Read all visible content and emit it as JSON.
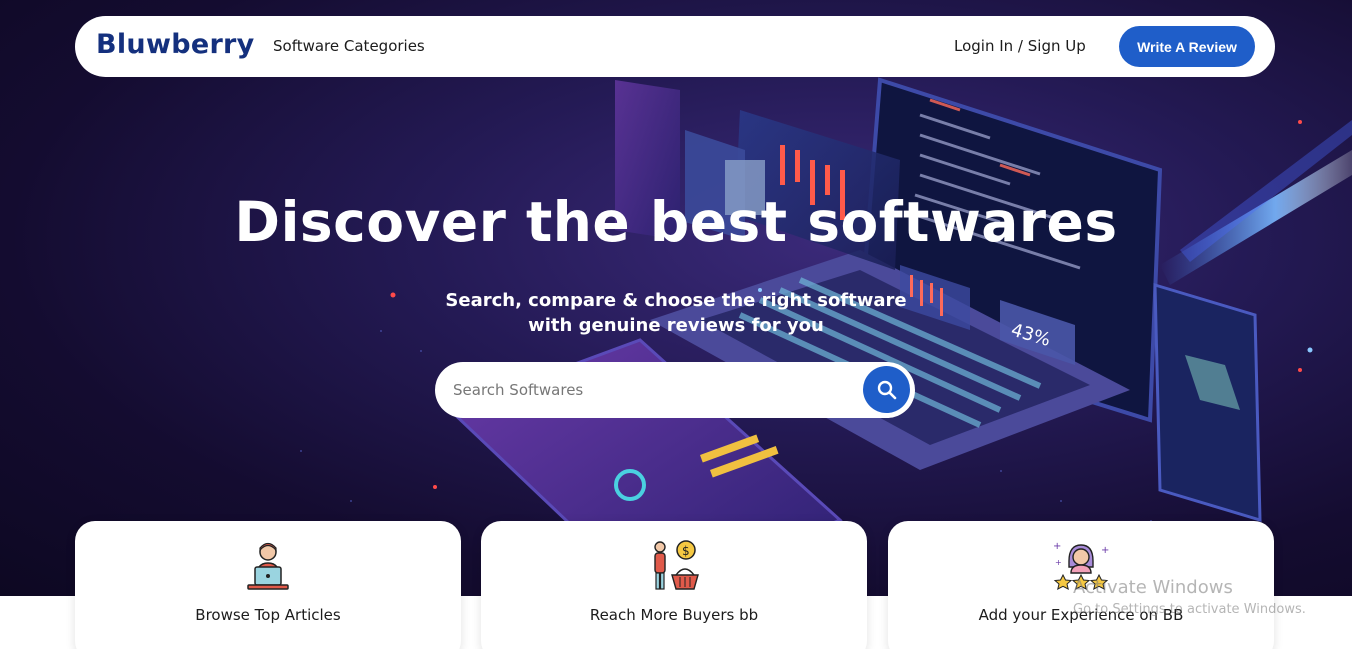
{
  "navbar": {
    "logo": "Bluwberry",
    "categories_label": "Software Categories",
    "login_label": "Login In / Sign Up",
    "write_review_label": "Write A Review"
  },
  "hero": {
    "title": "Discover the best softwares",
    "subtitle": "Search, compare & choose the right software with genuine reviews for you",
    "search_placeholder": "Search Softwares",
    "art_percent": "43%"
  },
  "cards": [
    {
      "label": "Browse Top Articles",
      "icon": "person-laptop-icon"
    },
    {
      "label": "Reach More Buyers bb",
      "icon": "buyer-basket-icon"
    },
    {
      "label": "Add your Experience on BB",
      "icon": "user-rating-stars-icon"
    }
  ],
  "watermark": {
    "title": "Activate Windows",
    "subtitle": "Go to Settings to activate Windows."
  },
  "colors": {
    "brand": "#14307e",
    "accent": "#1f5ec9",
    "hero_bg": "#140c30"
  }
}
